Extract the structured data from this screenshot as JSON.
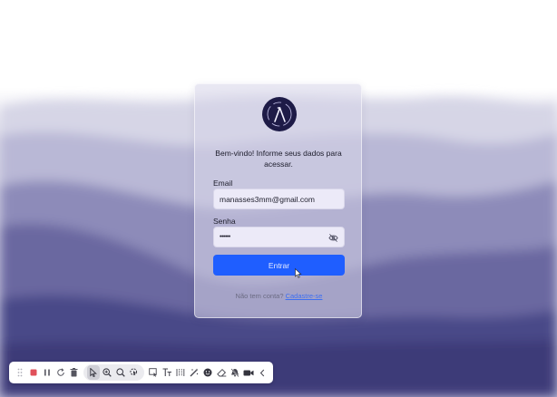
{
  "login": {
    "welcome_text": "Bem-vindo! Informe seus dados para acessar.",
    "email_label": "Email",
    "email_value": "manasses3mm@gmail.com",
    "password_label": "Senha",
    "password_value": "••••••",
    "submit_label": "Entrar",
    "signup_prompt": "Não tem conta?",
    "signup_link": "Cadastre-se"
  },
  "toolbar": {
    "items": [
      {
        "icon": "drag-handle-icon"
      },
      {
        "icon": "stop-icon",
        "color": "#e0505a"
      },
      {
        "icon": "pause-icon"
      },
      {
        "icon": "restart-icon"
      },
      {
        "icon": "delete-icon"
      },
      {
        "icon": "cursor-icon",
        "active": true
      },
      {
        "icon": "zoom-in-icon"
      },
      {
        "icon": "zoom-out-icon"
      },
      {
        "icon": "spotlight-icon"
      },
      {
        "icon": "rectangle-select-icon"
      },
      {
        "icon": "text-icon"
      },
      {
        "icon": "blur-icon"
      },
      {
        "icon": "magic-wand-icon"
      },
      {
        "icon": "emoji-icon"
      },
      {
        "icon": "eraser-icon"
      },
      {
        "icon": "hide-annotations-icon"
      },
      {
        "icon": "camera-icon"
      },
      {
        "icon": "collapse-icon"
      }
    ]
  },
  "colors": {
    "primary": "#1f5eff",
    "logo_bg": "#1e1b47",
    "background_top": "#ffffff",
    "background_bottom": "#3c3a78"
  }
}
